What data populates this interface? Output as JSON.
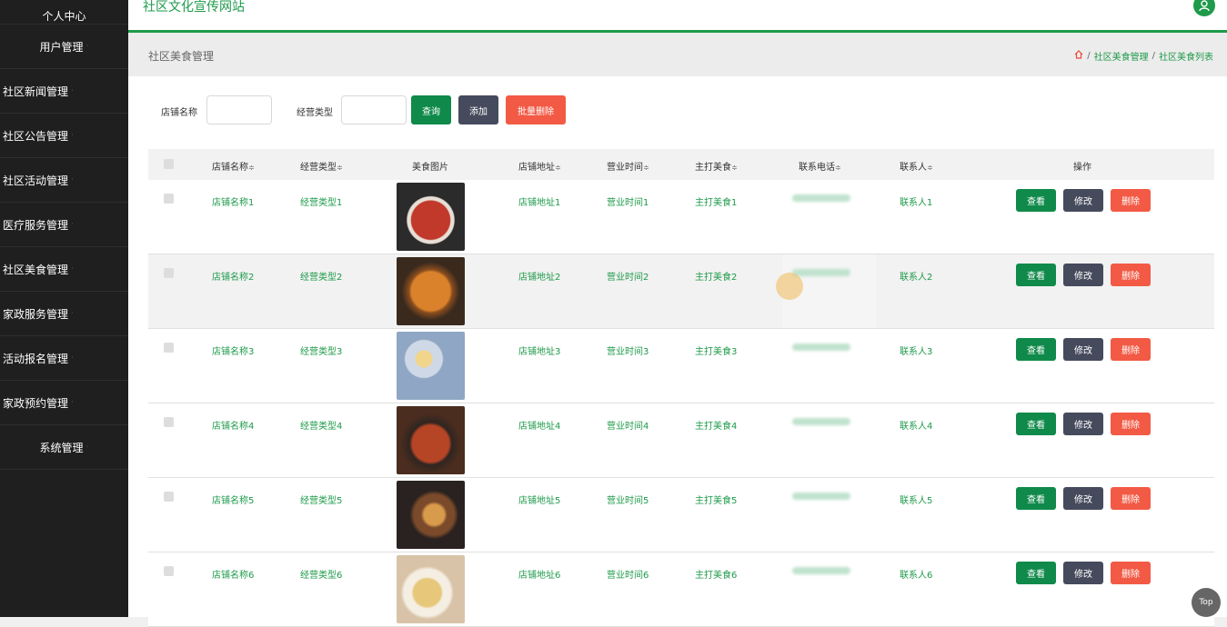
{
  "sidebar": {
    "items": [
      {
        "label": "个人中心"
      },
      {
        "label": "用户管理"
      },
      {
        "label": "社区新闻管理"
      },
      {
        "label": "社区公告管理"
      },
      {
        "label": "社区活动管理"
      },
      {
        "label": "医疗服务管理"
      },
      {
        "label": "社区美食管理"
      },
      {
        "label": "家政服务管理"
      },
      {
        "label": "活动报名管理"
      },
      {
        "label": "家政预约管理"
      },
      {
        "label": "系统管理"
      }
    ]
  },
  "header": {
    "site_title": "社区文化宣传网站",
    "avatar_icon": "user-icon"
  },
  "breadcrumb": {
    "page_title": "社区美食管理",
    "home_icon": "home-icon",
    "crumb1": "社区美食管理",
    "crumb2": "社区美食列表",
    "separator": "/"
  },
  "search": {
    "shop_label": "店铺名称",
    "type_label": "经营类型",
    "query_button": "查询",
    "add_button": "添加",
    "batch_delete_button": "批量删除"
  },
  "table": {
    "headers": {
      "shop": "店铺名称",
      "type": "经营类型",
      "image": "美食图片",
      "address": "店铺地址",
      "hours": "营业时间",
      "signature": "主打美食",
      "phone": "联系电话",
      "contact": "联系人",
      "actions": "操作"
    },
    "sort_glyph": "≑",
    "rows": [
      {
        "shop": "店铺名称1",
        "type": "经营类型1",
        "address": "店铺地址1",
        "hours": "营业时间1",
        "signature": "主打美食1",
        "contact": "联系人1"
      },
      {
        "shop": "店铺名称2",
        "type": "经营类型2",
        "address": "店铺地址2",
        "hours": "营业时间2",
        "signature": "主打美食2",
        "contact": "联系人2"
      },
      {
        "shop": "店铺名称3",
        "type": "经营类型3",
        "address": "店铺地址3",
        "hours": "营业时间3",
        "signature": "主打美食3",
        "contact": "联系人3"
      },
      {
        "shop": "店铺名称4",
        "type": "经营类型4",
        "address": "店铺地址4",
        "hours": "营业时间4",
        "signature": "主打美食4",
        "contact": "联系人4"
      },
      {
        "shop": "店铺名称5",
        "type": "经营类型5",
        "address": "店铺地址5",
        "hours": "营业时间5",
        "signature": "主打美食5",
        "contact": "联系人5"
      },
      {
        "shop": "店铺名称6",
        "type": "经营类型6",
        "address": "店铺地址6",
        "hours": "营业时间6",
        "signature": "主打美食6",
        "contact": "联系人6"
      }
    ],
    "actions": {
      "view": "查看",
      "edit": "修改",
      "delete": "删除"
    }
  },
  "top_button": "Top",
  "colors": {
    "accent": "#1e9a4a",
    "button_green": "#0f8a4a",
    "button_dark": "#454a5c",
    "button_red": "#f25a45",
    "sidebar_bg": "#1f1f1f"
  }
}
